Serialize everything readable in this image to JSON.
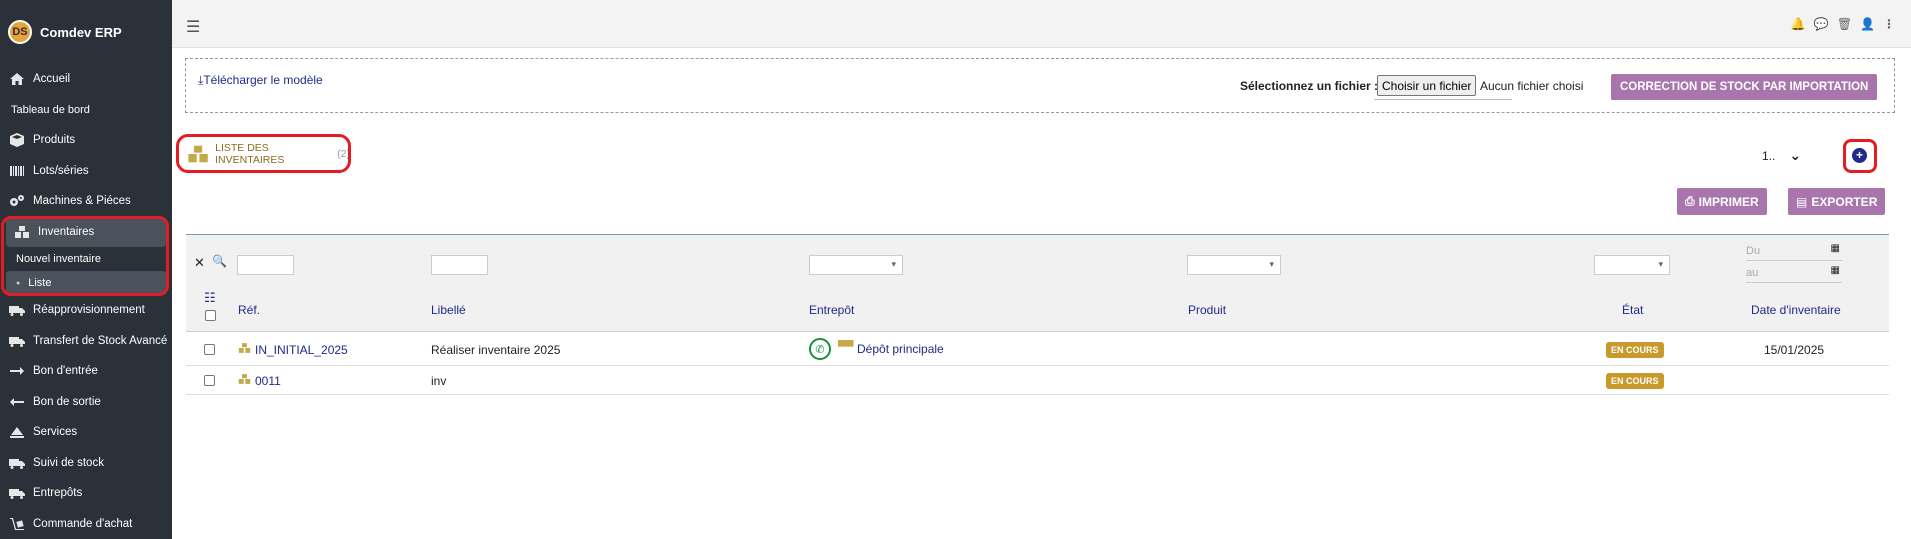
{
  "app": {
    "name": "Comdev ERP",
    "logo_text": "DS"
  },
  "sidebar": {
    "items": [
      {
        "label": "Accueil",
        "icon": "home-icon"
      },
      {
        "label": "Tableau de bord"
      },
      {
        "label": "Produits",
        "icon": "box-icon"
      },
      {
        "label": "Lots/séries",
        "icon": "barcode-icon"
      },
      {
        "label": "Machines & Piéces",
        "icon": "cogs-icon"
      },
      {
        "label": "Inventaires",
        "icon": "boxes-icon"
      },
      {
        "label": "Nouvel inventaire"
      },
      {
        "label": "Liste"
      },
      {
        "label": "Réapprovisionnement",
        "icon": "truck-icon"
      },
      {
        "label": "Transfert de Stock Avancé",
        "icon": "truck-icon"
      },
      {
        "label": "Bon d'entrée",
        "icon": "arrow-right-icon"
      },
      {
        "label": "Bon de sortie",
        "icon": "arrow-left-icon"
      },
      {
        "label": "Services",
        "icon": "services-icon"
      },
      {
        "label": "Suivi de stock",
        "icon": "truck-icon"
      },
      {
        "label": "Entrepôts",
        "icon": "warehouse-icon"
      },
      {
        "label": "Commande d'achat",
        "icon": "dolly-icon"
      }
    ]
  },
  "import": {
    "download_label": "Télécharger le modèle",
    "file_label": "Sélectionnez un fichier :",
    "file_button": "Choisir un fichier",
    "file_none": "Aucun fichier choisi",
    "submit_label": "CORRECTION DE STOCK PAR IMPORTATION"
  },
  "list": {
    "title": "LISTE DES INVENTAIRES",
    "count": "(2)",
    "pager_value": "1..",
    "add_label": "+",
    "print_label": "IMPRIMER",
    "export_label": "EXPORTER"
  },
  "filters": {
    "date_from_placeholder": "Du",
    "date_to_placeholder": "au"
  },
  "columns": [
    "Réf.",
    "Libellé",
    "Entrepôt",
    "Produit",
    "État",
    "Date d'inventaire"
  ],
  "rows": [
    {
      "ref": "IN_INITIAL_2025",
      "label": "Réaliser inventaire 2025",
      "warehouse": "Dépôt principale",
      "product": "",
      "status": "EN COURS",
      "date": "15/01/2025"
    },
    {
      "ref": "0011",
      "label": "inv",
      "warehouse": "",
      "product": "",
      "status": "EN COURS",
      "date": ""
    }
  ],
  "colors": {
    "sidebar_bg": "#2b3139",
    "accent": "#a876ad",
    "link": "#1f2a8a",
    "badge": "#c79a2b",
    "highlight": "#e41d24"
  }
}
